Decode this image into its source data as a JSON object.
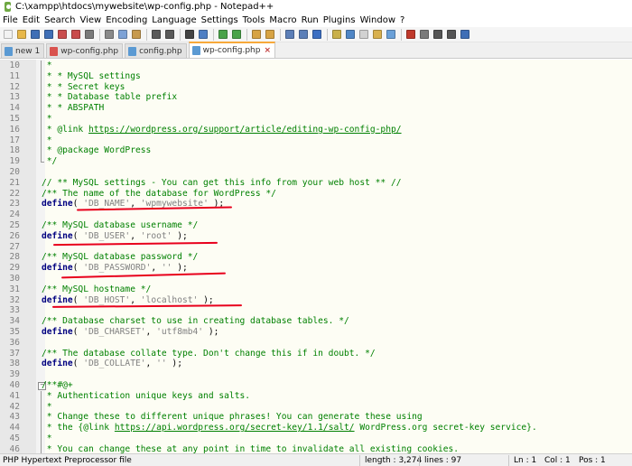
{
  "window": {
    "title": "C:\\xampp\\htdocs\\mywebsite\\wp-config.php - Notepad++"
  },
  "menu": [
    "File",
    "Edit",
    "Search",
    "View",
    "Encoding",
    "Language",
    "Settings",
    "Tools",
    "Macro",
    "Run",
    "Plugins",
    "Window",
    "?"
  ],
  "toolbar": {
    "buttons": [
      {
        "name": "new-file-icon",
        "color": "#f2f2f2"
      },
      {
        "name": "open-file-icon",
        "color": "#e8b84a"
      },
      {
        "name": "save-icon",
        "color": "#3f6fb6"
      },
      {
        "name": "save-all-icon",
        "color": "#3f6fb6"
      },
      {
        "name": "close-icon",
        "color": "#c94c4c"
      },
      {
        "name": "close-all-icon",
        "color": "#c94c4c"
      },
      {
        "name": "print-icon",
        "color": "#7a7a7a"
      },
      {
        "name": "sep"
      },
      {
        "name": "cut-icon",
        "color": "#8a8a8a"
      },
      {
        "name": "copy-icon",
        "color": "#7da2d6"
      },
      {
        "name": "paste-icon",
        "color": "#c79a4e"
      },
      {
        "name": "sep"
      },
      {
        "name": "undo-icon",
        "color": "#5a5a5a"
      },
      {
        "name": "redo-icon",
        "color": "#5a5a5a"
      },
      {
        "name": "sep"
      },
      {
        "name": "find-icon",
        "color": "#444444"
      },
      {
        "name": "replace-icon",
        "color": "#4e7fc4"
      },
      {
        "name": "sep"
      },
      {
        "name": "zoom-in-icon",
        "color": "#4aa34a"
      },
      {
        "name": "zoom-out-icon",
        "color": "#4aa34a"
      },
      {
        "name": "sep"
      },
      {
        "name": "sync-vertical-icon",
        "color": "#d7a344"
      },
      {
        "name": "sync-horizontal-icon",
        "color": "#d7a344"
      },
      {
        "name": "sep"
      },
      {
        "name": "word-wrap-icon",
        "color": "#5c7fb8"
      },
      {
        "name": "show-all-chars-icon",
        "color": "#5c7fb8"
      },
      {
        "name": "indent-guide-icon",
        "color": "#3c6fc2"
      },
      {
        "name": "sep"
      },
      {
        "name": "udl-icon",
        "color": "#c9b04a"
      },
      {
        "name": "doc-map-icon",
        "color": "#4f86c6"
      },
      {
        "name": "function-list-icon",
        "color": "#d2d2d2"
      },
      {
        "name": "folder-workspace-icon",
        "color": "#d8b04e"
      },
      {
        "name": "monitoring-icon",
        "color": "#6aa0d8"
      },
      {
        "name": "sep"
      },
      {
        "name": "record-macro-icon",
        "color": "#c0392b"
      },
      {
        "name": "stop-record-icon",
        "color": "#7a7a7a"
      },
      {
        "name": "playback-macro-icon",
        "color": "#555555"
      },
      {
        "name": "run-macro-multiple-icon",
        "color": "#555555"
      },
      {
        "name": "save-macro-icon",
        "color": "#3f6fb6"
      }
    ]
  },
  "tabs": [
    {
      "label": "new 1",
      "state": "normal"
    },
    {
      "label": "wp-config.php",
      "state": "dirty"
    },
    {
      "label": "config.php",
      "state": "normal"
    },
    {
      "label": "wp-config.php",
      "state": "active",
      "close": "×"
    }
  ],
  "editor": {
    "lines": [
      {
        "n": "10",
        "fold": "bar",
        "parts": [
          {
            "t": " *",
            "c": "cm"
          }
        ]
      },
      {
        "n": "11",
        "fold": "bar",
        "parts": [
          {
            "t": " * * MySQL settings",
            "c": "cm"
          }
        ]
      },
      {
        "n": "12",
        "fold": "bar",
        "parts": [
          {
            "t": " * * Secret keys",
            "c": "cm"
          }
        ]
      },
      {
        "n": "13",
        "fold": "bar",
        "parts": [
          {
            "t": " * * Database table prefix",
            "c": "cm"
          }
        ]
      },
      {
        "n": "14",
        "fold": "bar",
        "parts": [
          {
            "t": " * * ABSPATH",
            "c": "cm"
          }
        ]
      },
      {
        "n": "15",
        "fold": "bar",
        "parts": [
          {
            "t": " *",
            "c": "cm"
          }
        ]
      },
      {
        "n": "16",
        "fold": "bar",
        "parts": [
          {
            "t": " * @link ",
            "c": "cm"
          },
          {
            "t": "https://wordpress.org/support/article/editing-wp-config-php/",
            "c": "cm lk"
          }
        ]
      },
      {
        "n": "17",
        "fold": "bar",
        "parts": [
          {
            "t": " *",
            "c": "cm"
          }
        ]
      },
      {
        "n": "18",
        "fold": "bar",
        "parts": [
          {
            "t": " * @package WordPress",
            "c": "cm"
          }
        ]
      },
      {
        "n": "19",
        "fold": "end",
        "parts": [
          {
            "t": " */",
            "c": "cm"
          }
        ]
      },
      {
        "n": "20",
        "fold": "",
        "parts": []
      },
      {
        "n": "21",
        "fold": "",
        "parts": [
          {
            "t": "// ** MySQL settings - You can get this info from your web host ** //",
            "c": "cm"
          }
        ]
      },
      {
        "n": "22",
        "fold": "",
        "parts": [
          {
            "t": "/** The name of the database for WordPress */",
            "c": "cm"
          }
        ]
      },
      {
        "n": "23",
        "fold": "",
        "parts": [
          {
            "t": "define",
            "c": "kw"
          },
          {
            "t": "( ",
            "c": "op"
          },
          {
            "t": "'DB_NAME'",
            "c": "st"
          },
          {
            "t": ", ",
            "c": "op"
          },
          {
            "t": "'wpmywebsite'",
            "c": "st"
          },
          {
            "t": " );",
            "c": "op"
          }
        ]
      },
      {
        "n": "24",
        "fold": "",
        "parts": []
      },
      {
        "n": "25",
        "fold": "",
        "parts": [
          {
            "t": "/** MySQL database username */",
            "c": "cm"
          }
        ]
      },
      {
        "n": "26",
        "fold": "",
        "parts": [
          {
            "t": "define",
            "c": "kw"
          },
          {
            "t": "( ",
            "c": "op"
          },
          {
            "t": "'DB_USER'",
            "c": "st"
          },
          {
            "t": ", ",
            "c": "op"
          },
          {
            "t": "'root'",
            "c": "st"
          },
          {
            "t": " );",
            "c": "op"
          }
        ]
      },
      {
        "n": "27",
        "fold": "",
        "parts": []
      },
      {
        "n": "28",
        "fold": "",
        "parts": [
          {
            "t": "/** MySQL database password */",
            "c": "cm"
          }
        ]
      },
      {
        "n": "29",
        "fold": "",
        "parts": [
          {
            "t": "define",
            "c": "kw"
          },
          {
            "t": "( ",
            "c": "op"
          },
          {
            "t": "'DB_PASSWORD'",
            "c": "st"
          },
          {
            "t": ", ",
            "c": "op"
          },
          {
            "t": "''",
            "c": "st"
          },
          {
            "t": " );",
            "c": "op"
          }
        ]
      },
      {
        "n": "30",
        "fold": "",
        "parts": []
      },
      {
        "n": "31",
        "fold": "",
        "parts": [
          {
            "t": "/** MySQL hostname */",
            "c": "cm"
          }
        ]
      },
      {
        "n": "32",
        "fold": "",
        "parts": [
          {
            "t": "define",
            "c": "kw"
          },
          {
            "t": "( ",
            "c": "op"
          },
          {
            "t": "'DB_HOST'",
            "c": "st"
          },
          {
            "t": ", ",
            "c": "op"
          },
          {
            "t": "'localhost'",
            "c": "st"
          },
          {
            "t": " );",
            "c": "op"
          }
        ]
      },
      {
        "n": "33",
        "fold": "",
        "parts": []
      },
      {
        "n": "34",
        "fold": "",
        "parts": [
          {
            "t": "/** Database charset to use in creating database tables. */",
            "c": "cm"
          }
        ]
      },
      {
        "n": "35",
        "fold": "",
        "parts": [
          {
            "t": "define",
            "c": "kw"
          },
          {
            "t": "( ",
            "c": "op"
          },
          {
            "t": "'DB_CHARSET'",
            "c": "st"
          },
          {
            "t": ", ",
            "c": "op"
          },
          {
            "t": "'utf8mb4'",
            "c": "st"
          },
          {
            "t": " );",
            "c": "op"
          }
        ]
      },
      {
        "n": "36",
        "fold": "",
        "parts": []
      },
      {
        "n": "37",
        "fold": "",
        "parts": [
          {
            "t": "/** The database collate type. Don't change this if in doubt. */",
            "c": "cm"
          }
        ]
      },
      {
        "n": "38",
        "fold": "",
        "parts": [
          {
            "t": "define",
            "c": "kw"
          },
          {
            "t": "( ",
            "c": "op"
          },
          {
            "t": "'DB_COLLATE'",
            "c": "st"
          },
          {
            "t": ", ",
            "c": "op"
          },
          {
            "t": "''",
            "c": "st"
          },
          {
            "t": " );",
            "c": "op"
          }
        ]
      },
      {
        "n": "39",
        "fold": "",
        "parts": []
      },
      {
        "n": "40",
        "fold": "box",
        "parts": [
          {
            "t": "/**#@+",
            "c": "cm"
          }
        ]
      },
      {
        "n": "41",
        "fold": "bar",
        "parts": [
          {
            "t": " * Authentication unique keys and salts.",
            "c": "cm"
          }
        ]
      },
      {
        "n": "42",
        "fold": "bar",
        "parts": [
          {
            "t": " *",
            "c": "cm"
          }
        ]
      },
      {
        "n": "43",
        "fold": "bar",
        "parts": [
          {
            "t": " * Change these to different unique phrases! You can generate these using",
            "c": "cm"
          }
        ]
      },
      {
        "n": "44",
        "fold": "bar",
        "parts": [
          {
            "t": " * the {@link ",
            "c": "cm"
          },
          {
            "t": "https://api.wordpress.org/secret-key/1.1/salt/",
            "c": "cm lk"
          },
          {
            "t": " WordPress.org secret-key service}.",
            "c": "cm"
          }
        ]
      },
      {
        "n": "45",
        "fold": "bar",
        "parts": [
          {
            "t": " *",
            "c": "cm"
          }
        ]
      },
      {
        "n": "46",
        "fold": "bar",
        "parts": [
          {
            "t": " * You can change these at any point in time to invalidate all existing cookies.",
            "c": "cm"
          }
        ]
      }
    ]
  },
  "status": {
    "lang": "PHP Hypertext Preprocessor file",
    "length": "length : 3,274",
    "lines": "lines : 97",
    "ln": "Ln : 1",
    "col": "Col : 1",
    "pos": "Pos : 1"
  },
  "colors": {
    "comment": "#008000",
    "keyword": "#000080",
    "string": "#808080",
    "annotation": "#e8001c",
    "active_tab": "#f7a93a"
  }
}
